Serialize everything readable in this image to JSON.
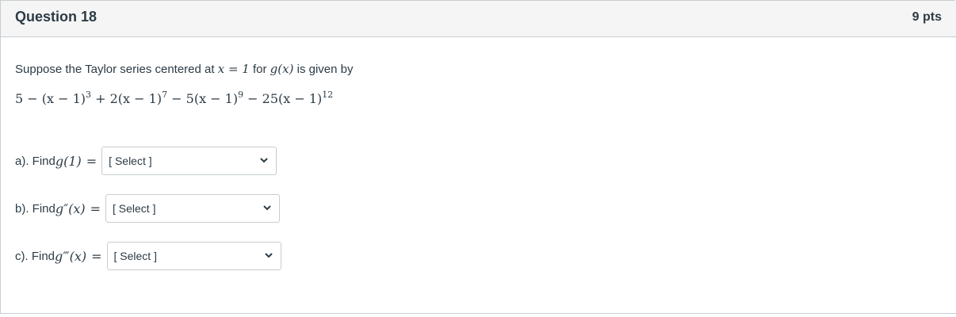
{
  "question": {
    "title": "Question 18",
    "points": "9 pts"
  },
  "intro": {
    "text_before": "Suppose the Taylor series centered at ",
    "center_math": "x = 1",
    "text_middle": " for ",
    "func_math": "g(x)",
    "text_after": " is given by"
  },
  "series": {
    "t1": "5 − (x − 1)",
    "e1": "3",
    "t2": " + 2(x − 1)",
    "e2": "7",
    "t3": " − 5(x − 1)",
    "e3": "9",
    "t4": " − 25(x − 1)",
    "e4": "12"
  },
  "parts": [
    {
      "label": "a). Find ",
      "math": "g(1)",
      "equals": "=",
      "select_value": "[ Select ]"
    },
    {
      "label": "b). Find ",
      "math": "g″(x)",
      "equals": "=",
      "select_value": "[ Select ]"
    },
    {
      "label": "c). Find ",
      "math": "g‴(x)",
      "equals": "=",
      "select_value": "[ Select ]"
    }
  ],
  "icons": {
    "dropdown": "chevron-down-icon"
  }
}
